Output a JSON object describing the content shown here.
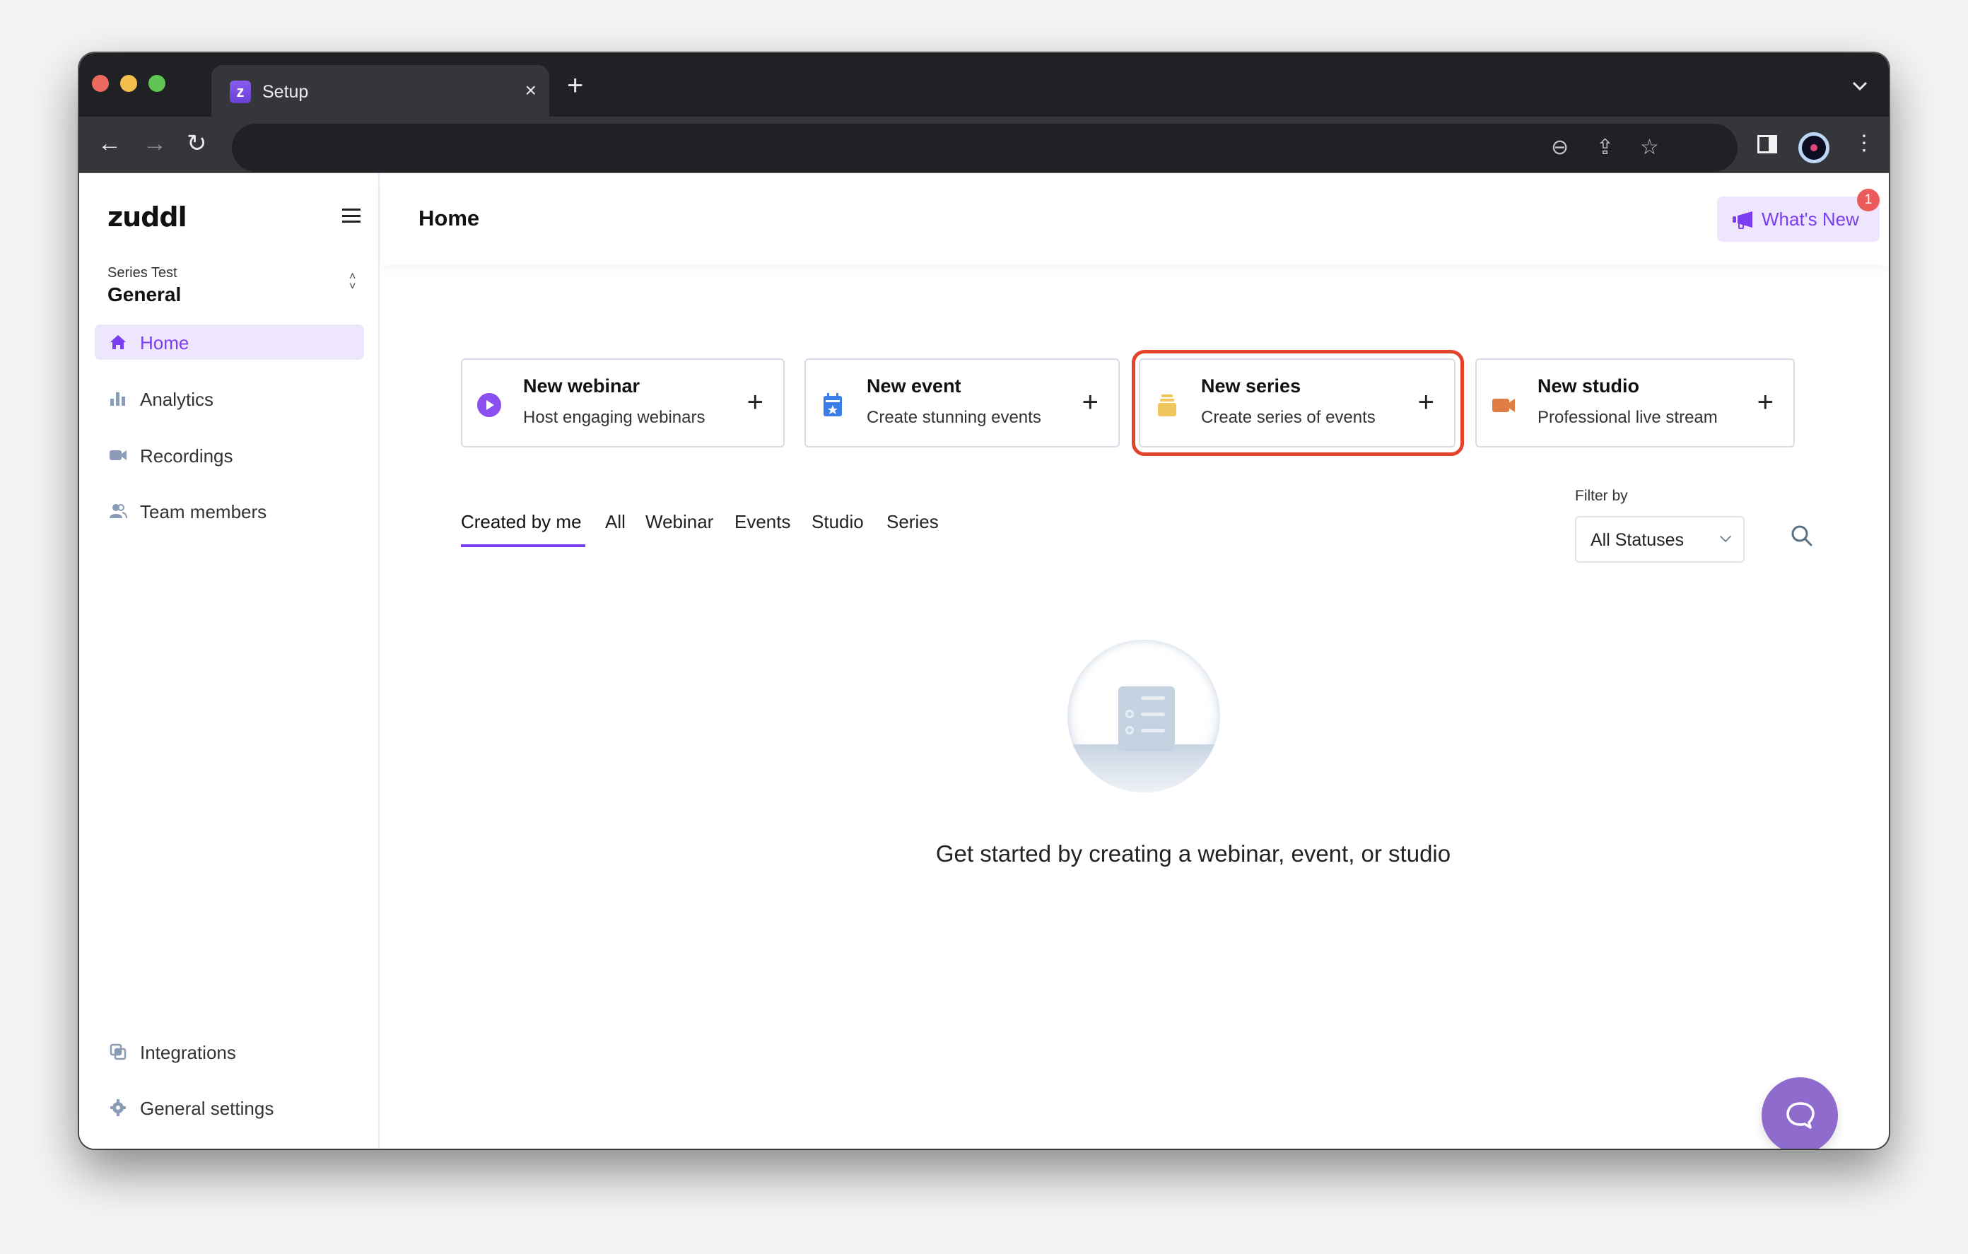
{
  "browser": {
    "tab_title": "Setup",
    "tab_favicon": "zuddl-logo",
    "tab_close": "×",
    "new_tab": "+",
    "tab_menu": "⌄",
    "back": "←",
    "forward": "→",
    "reload": "↻",
    "omnibox_icons": [
      "zoom-out-icon",
      "share-icon",
      "bookmark-star-icon"
    ],
    "toolbar_icons": [
      "side-panel-icon",
      "profile-avatar",
      "more-menu-icon"
    ],
    "zoom_glyph": "⊖",
    "share_glyph": "⇪",
    "star_glyph": "☆",
    "more_glyph": "⋮"
  },
  "sidebar": {
    "logo": "zuddl",
    "workspace_label": "Series Test",
    "workspace_name": "General",
    "items": [
      {
        "label": "Home",
        "icon": "home-icon",
        "active": true
      },
      {
        "label": "Analytics",
        "icon": "bar-chart-icon"
      },
      {
        "label": "Recordings",
        "icon": "video-camera-icon"
      },
      {
        "label": "Team members",
        "icon": "team-icon"
      }
    ],
    "bottom_items": [
      {
        "label": "Integrations",
        "icon": "integrations-icon"
      },
      {
        "label": "General settings",
        "icon": "gear-icon"
      }
    ]
  },
  "header": {
    "title": "Home",
    "whats_new_label": "What's New",
    "whats_new_badge": "1"
  },
  "create_cards": [
    {
      "title": "New webinar",
      "subtitle": "Host engaging webinars",
      "icon": "play-icon",
      "color": "#8b4ef0"
    },
    {
      "title": "New event",
      "subtitle": "Create stunning events",
      "icon": "calendar-star-icon",
      "color": "#3b7de9"
    },
    {
      "title": "New series",
      "subtitle": "Create series of events",
      "icon": "stack-icon",
      "color": "#efc75e",
      "highlighted": true
    },
    {
      "title": "New studio",
      "subtitle": "Professional live stream",
      "icon": "video-camera-icon",
      "color": "#e07c45"
    }
  ],
  "card_plus": "+",
  "filter_tabs": [
    {
      "label": "Created by me",
      "active": true
    },
    {
      "label": "All"
    },
    {
      "label": "Webinar"
    },
    {
      "label": "Events"
    },
    {
      "label": "Studio"
    },
    {
      "label": "Series"
    }
  ],
  "filter": {
    "label": "Filter by",
    "selected": "All Statuses"
  },
  "empty_state": {
    "message": "Get started by creating a webinar, event, or studio"
  },
  "colors": {
    "accent": "#7a3df0",
    "accent_bg": "#eee6fc",
    "highlight": "#e2432b",
    "chat": "#8e6bcc",
    "badge": "#eb5b5b"
  }
}
